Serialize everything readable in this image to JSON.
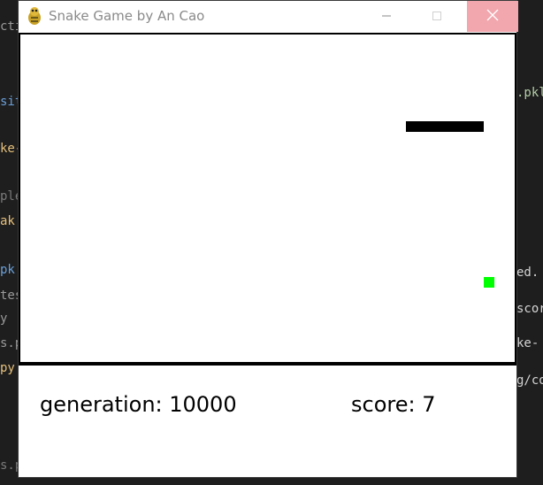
{
  "background_editor": {
    "left_fragments": [
      {
        "text": "ctic",
        "color": "#9a9a9a"
      },
      {
        "text": "sit",
        "color": "#6a9fd8"
      },
      {
        "text": "ke-",
        "color": "#e6c07b"
      },
      {
        "text": "ple",
        "color": "#7a7a7a"
      },
      {
        "text": "ak",
        "color": "#e6c07b"
      },
      {
        "text": "pk",
        "color": "#6a9fd8"
      },
      {
        "text": "test",
        "color": "#9a9a9a"
      },
      {
        "text": "y",
        "color": "#9a9a9a"
      },
      {
        "text": "s.py",
        "color": "#9a9a9a"
      },
      {
        "text": "py",
        "color": "#e6c07b"
      },
      {
        "text": "s.p",
        "color": "#7a7a7a"
      }
    ],
    "right_fragments": [
      {
        "text": ".pkl",
        "color": "#b5cea8"
      },
      {
        "text": "ed.",
        "color": "#d4d4d4"
      },
      {
        "text": "scor",
        "color": "#d4d4d4"
      },
      {
        "text": "ke-",
        "color": "#d4d4d4"
      },
      {
        "text": "g/co",
        "color": "#d4d4d4"
      }
    ]
  },
  "window": {
    "title": "Snake Game by An Cao",
    "icon": "pygame-snake-icon",
    "minimize_icon": "minimize-icon",
    "maximize_icon": "maximize-icon",
    "close_icon": "close-icon"
  },
  "game": {
    "snake_color": "#000000",
    "food_color": "#00ff00",
    "background_color": "#ffffff"
  },
  "status": {
    "generation": "generation: 10000",
    "score": "score: 7"
  }
}
